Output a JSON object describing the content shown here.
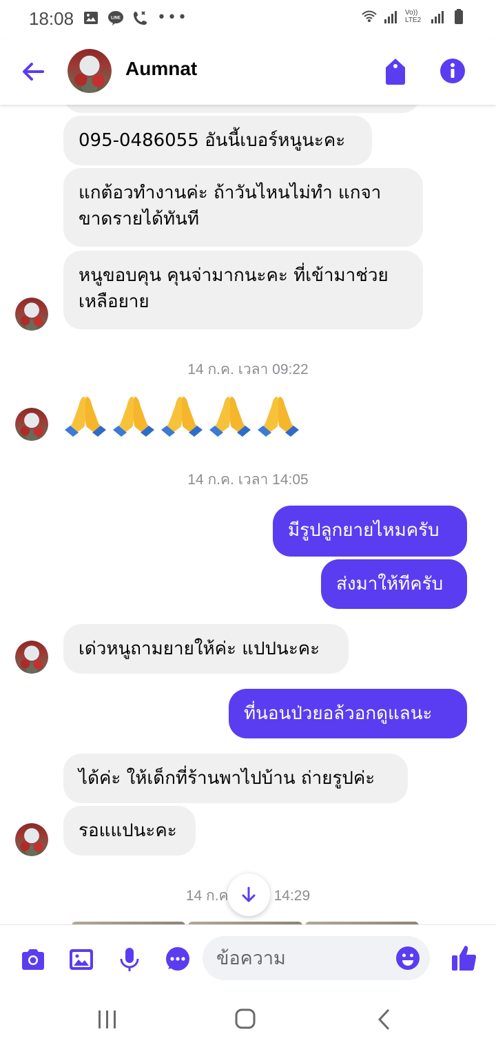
{
  "status_bar": {
    "time": "18:08",
    "left_icons": [
      "gallery-icon",
      "line-icon",
      "call-icon"
    ],
    "right_icons": [
      "wifi-icon",
      "signal-icon",
      "volte-icon",
      "signal-icon",
      "battery-icon"
    ],
    "volte_text": "Vo)) LTE2"
  },
  "header": {
    "contact_name": "Aumnat"
  },
  "messages": {
    "m1": "095-0486055 อันนี้เบอร์หนูนะคะ",
    "m2_line1": "แกต้อวทำงานค่ะ ถ้าวันไหนไม่ทำ แกจา",
    "m2_line2": "ขาดรายได้ทันที",
    "m3_line1": "หนูขอบคุน คุนจ่ามากนะคะ ที่เข้ามาช่วย",
    "m3_line2": "เหลือยาย",
    "ts1": "14 ก.ค. เวลา 09:22",
    "emoji_count": 5,
    "ts2": "14 ก.ค. เวลา 14:05",
    "out1": "มีรูปลูกยายไหมครับ",
    "out2": "ส่งมาให้ทีครับ",
    "m4": "เด่วหนูถามยายให้ค่ะ แปปนะคะ",
    "out3": "ที่นอนป่วยอล้วอกดูแลนะ",
    "m5": "ได้ค่ะ ให้เด็กที่ร้านพาไปบ้าน ถ่ายรูปค่ะ",
    "m6": "รอแแปนะคะ",
    "ts3_left": "14 ก.ค",
    "ts3_right": "14:29"
  },
  "composer": {
    "placeholder": "ข้อความ"
  },
  "colors": {
    "accent": "#5a3df0",
    "incoming_bubble": "#f0f0f0",
    "timestamp": "#8a8d91"
  }
}
